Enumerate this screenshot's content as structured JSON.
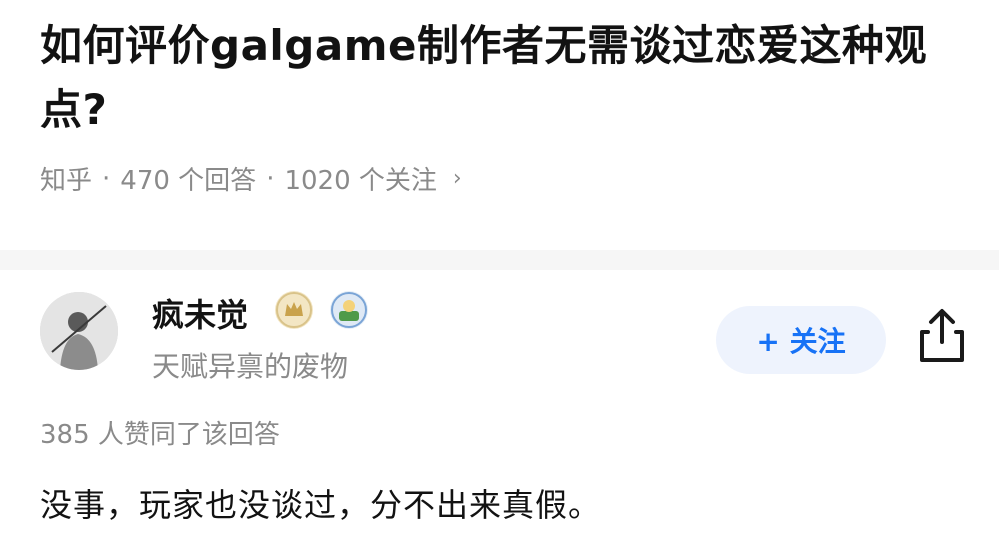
{
  "question": {
    "title": "如何评价galgame制作者无需谈过恋爱这种观点?",
    "source": "知乎",
    "answers": "470 个回答",
    "followers": "1020 个关注"
  },
  "author": {
    "name": "疯未觉",
    "bio": "天赋异禀的废物",
    "badges": [
      "crown-badge-icon",
      "pet-badge-icon"
    ]
  },
  "actions": {
    "follow_label": "+ 关注"
  },
  "answer": {
    "upvotes": "385 人赞同了该回答",
    "content": "没事，玩家也没谈过，分不出来真假。"
  },
  "colors": {
    "accent": "#1772f6",
    "muted": "#8a8a8a",
    "follow_bg": "#eef3fd"
  }
}
